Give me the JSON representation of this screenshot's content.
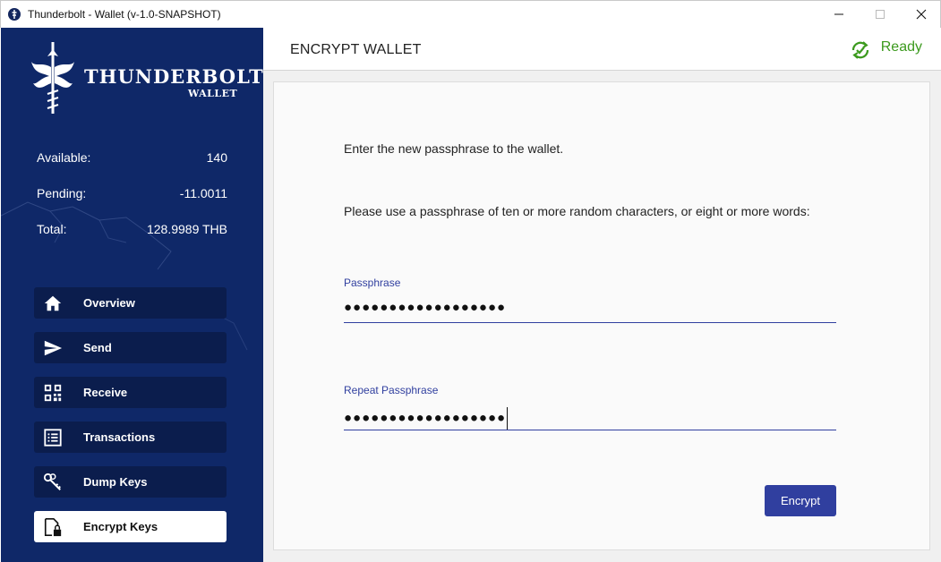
{
  "window": {
    "title": "Thunderbolt - Wallet (v-1.0-SNAPSHOT)",
    "controls": [
      "minimize-icon",
      "maximize-icon",
      "close-icon"
    ]
  },
  "sidebar": {
    "logo": {
      "title": "THUNDERBOLT",
      "subtitle": "WALLET"
    },
    "balances": {
      "available_label": "Available:",
      "available_value": "140",
      "pending_label": "Pending:",
      "pending_value": "-11.0011",
      "total_label": "Total:",
      "total_value": "128.9989 THB"
    },
    "nav": [
      {
        "label": "Overview",
        "icon": "home-icon",
        "active": false
      },
      {
        "label": "Send",
        "icon": "send-icon",
        "active": false
      },
      {
        "label": "Receive",
        "icon": "qr-code-icon",
        "active": false
      },
      {
        "label": "Transactions",
        "icon": "list-icon",
        "active": false
      },
      {
        "label": "Dump Keys",
        "icon": "keys-icon",
        "active": false
      },
      {
        "label": "Encrypt Keys",
        "icon": "file-lock-icon",
        "active": true
      }
    ]
  },
  "header": {
    "title": "ENCRYPT WALLET",
    "status": "Ready",
    "status_icon": "sync-check-icon"
  },
  "main": {
    "instruction_1": "Enter the new passphrase to the wallet.",
    "instruction_2": "Please use a passphrase of ten or more random characters, or eight or more words:",
    "passphrase": {
      "label": "Passphrase",
      "value": "●●●●●●●●●●●●●●●●●●"
    },
    "repeat_passphrase": {
      "label": "Repeat Passphrase",
      "value": "●●●●●●●●●●●●●●●●●●"
    },
    "encrypt_button": "Encrypt"
  },
  "colors": {
    "sidebar_bg": "#0f2868",
    "nav_item_bg": "#0b1d4d",
    "accent": "#303f9f",
    "status_green": "#3c9a1e"
  }
}
